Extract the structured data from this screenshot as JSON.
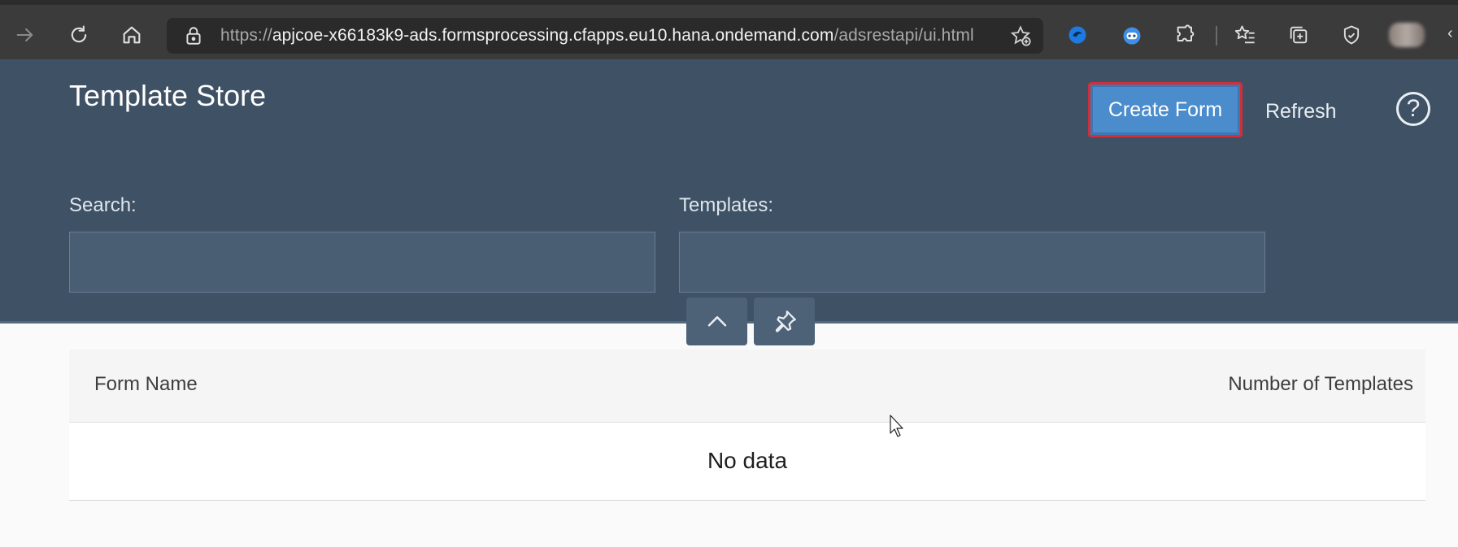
{
  "browser": {
    "url_scheme": "https://",
    "url_host": "apjcoe-x66183k9-ads.formsprocessing.cfapps.eu10.hana.ondemand.com",
    "url_path": "/adsrestapi/ui.html",
    "icons": [
      "forward-icon",
      "refresh-icon",
      "home-icon",
      "lock-icon",
      "add-favorite-icon",
      "extension-blue-icon",
      "robot-extension-icon",
      "puzzle-extensions-icon",
      "favorites-list-icon",
      "collections-icon",
      "performance-icon",
      "profile-avatar"
    ]
  },
  "app": {
    "title": "Template Store",
    "create_form_label": "Create Form",
    "refresh_label": "Refresh",
    "help_symbol": "?",
    "search_label": "Search:",
    "templates_label": "Templates:",
    "search_value": "",
    "templates_value": ""
  },
  "table": {
    "columns": [
      "Form Name",
      "Number of Templates"
    ],
    "empty_text": "No data"
  },
  "colors": {
    "header_bg": "#3f5164",
    "accent_button": "#4a8ccc",
    "highlight_border": "#d0303a"
  }
}
